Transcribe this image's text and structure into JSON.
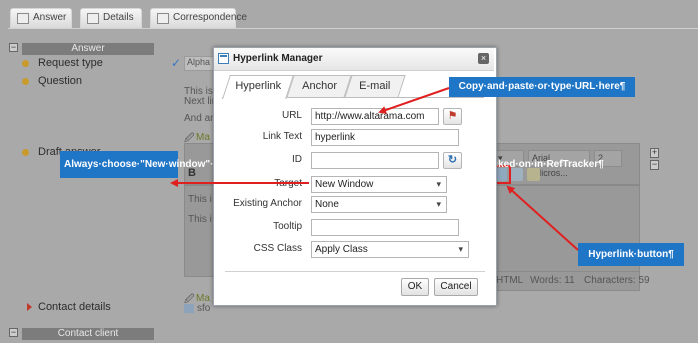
{
  "tabs": [
    {
      "label": "Answer"
    },
    {
      "label": "Details"
    },
    {
      "label": "Correspondence"
    }
  ],
  "page": {
    "answer_section": "Answer",
    "request_type_label": "Request type",
    "request_type_value": "Alpha",
    "question_label": "Question",
    "question_text_1": "This is",
    "question_text_2": "Next lin",
    "question_text_3": "And an",
    "draft_answer_label": "Draft answer",
    "editor_text_1": "This i",
    "editor_text_2": "This i",
    "editor_bold": "B",
    "font_select": "Arial, 'Micros...",
    "size_select": "2",
    "html_label": "HTML",
    "words": "Words: 11",
    "characters": "Characters: 59",
    "contact_details_label": "Contact details",
    "contact_client_section": "Contact client",
    "sfo_text": "sfo",
    "ma_text_1": "Ma",
    "ma_text_2": "Ma"
  },
  "dialog": {
    "title": "Hyperlink Manager",
    "tabs": [
      "Hyperlink",
      "Anchor",
      "E-mail"
    ],
    "url_label": "URL",
    "url_value": "http://www.altarama.com",
    "link_text_label": "Link Text",
    "link_text_value": "hyperlink",
    "id_label": "ID",
    "id_value": "",
    "target_label": "Target",
    "target_value": "New Window",
    "existing_anchor_label": "Existing Anchor",
    "existing_anchor_value": "None",
    "tooltip_label": "Tooltip",
    "tooltip_value": "",
    "css_class_label": "CSS Class",
    "css_class_value": "Apply Class",
    "ok_label": "OK",
    "cancel_label": "Cancel"
  },
  "callouts": {
    "url": "Copy·and·paste·or·type·URL·here¶",
    "window": "Always·choose·\"New·window\"·here·so·that·the·page·will·open·in·a·new·window,·when·clicked·on·in·RefTracker¶",
    "hyperlink_button": "Hyperlink·button¶"
  },
  "colors": {
    "callout": "#1f75c6",
    "arrow": "#e02020",
    "overlay": "#a9a9a9"
  }
}
